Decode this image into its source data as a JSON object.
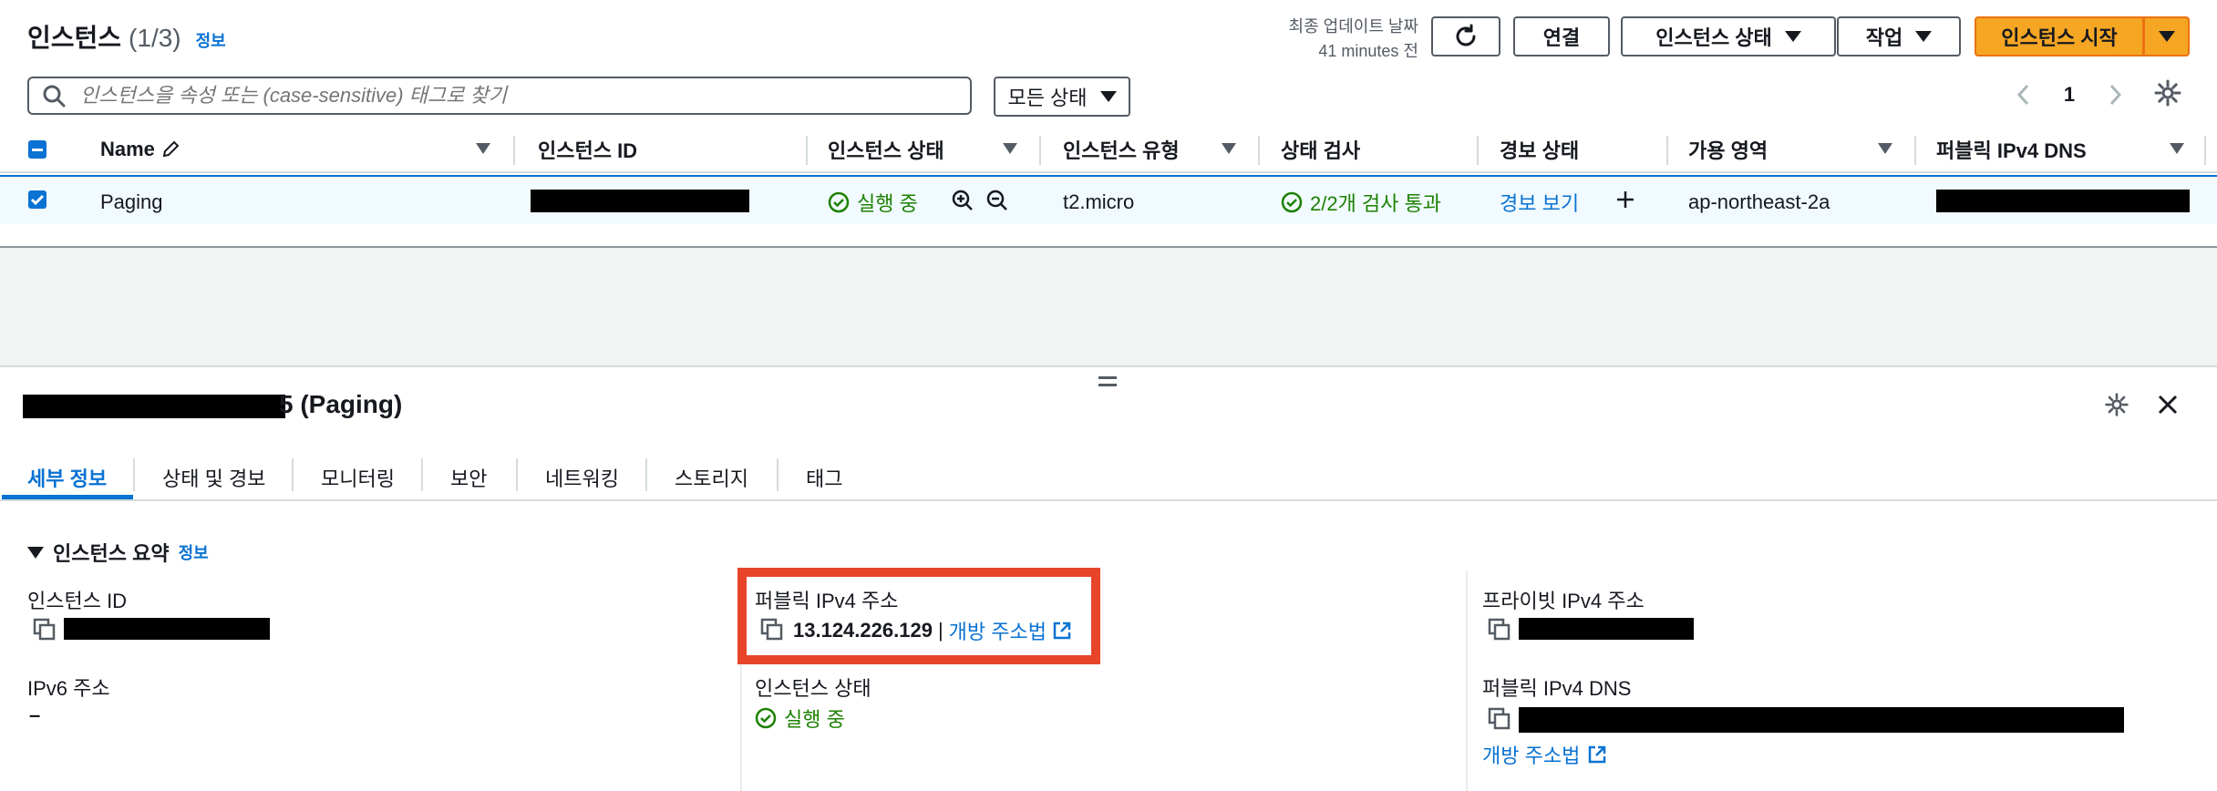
{
  "header": {
    "title": "인스턴스",
    "count": "(1/3)",
    "info_link": "정보",
    "last_updated_label": "최종 업데이트 날짜",
    "last_updated_value": "41 minutes 전",
    "buttons": {
      "connect": "연결",
      "instance_state": "인스턴스 상태",
      "actions": "작업",
      "launch": "인스턴스 시작"
    }
  },
  "search": {
    "placeholder": "인스턴스을 속성 또는 (case-sensitive) 태그로 찾기"
  },
  "filter": {
    "state_label": "모든 상태"
  },
  "pagination": {
    "page": "1"
  },
  "table": {
    "columns": [
      "Name",
      "인스턴스 ID",
      "인스턴스 상태",
      "인스턴스 유형",
      "상태 검사",
      "경보 상태",
      "가용 영역",
      "퍼블릭 IPv4 DNS"
    ],
    "row": {
      "name": "Paging",
      "state": "실행 중",
      "type": "t2.micro",
      "status_check": "2/2개 검사 통과",
      "alarm": "경보 보기",
      "az": "ap-northeast-2a"
    }
  },
  "details": {
    "title_suffix": "5 (Paging)",
    "tabs": [
      "세부 정보",
      "상태 및 경보",
      "모니터링",
      "보안",
      "네트워킹",
      "스토리지",
      "태그"
    ],
    "summary_label": "인스턴스 요약",
    "summary_info": "정보",
    "fields": {
      "instance_id": "인스턴스 ID",
      "ipv6": "IPv6 주소",
      "ipv6_value": "–",
      "public_ipv4": "퍼블릭 IPv4 주소",
      "public_ipv4_value": "13.124.226.129",
      "public_ipv4_sep": "|",
      "open_address": "개방 주소법",
      "instance_state": "인스턴스 상태",
      "instance_state_value": "실행 중",
      "private_ipv4": "프라이빗 IPv4 주소",
      "public_dns": "퍼블릭 IPv4 DNS",
      "open_address_2": "개방 주소법"
    }
  },
  "colors": {
    "accent": "#0972d3",
    "primary": "#f5a623",
    "success": "#1d8102",
    "highlight": "#e8442b",
    "selected_row": "#f1faff"
  }
}
